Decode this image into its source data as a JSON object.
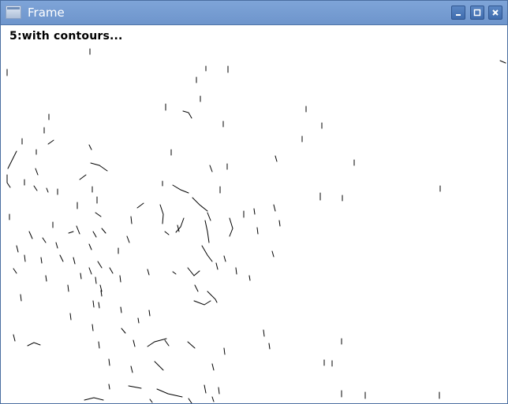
{
  "window": {
    "title": "Frame",
    "app_icon": "window-icon",
    "controls": [
      {
        "name": "minimize",
        "icon": "minimize-icon"
      },
      {
        "name": "maximize",
        "icon": "maximize-icon"
      },
      {
        "name": "close",
        "icon": "close-icon"
      }
    ]
  },
  "content": {
    "caption": "5:with contours..."
  },
  "colors": {
    "titlebar": "#7aa0d4",
    "contour_stroke": "#000000",
    "canvas_background": "#ffffff"
  }
}
